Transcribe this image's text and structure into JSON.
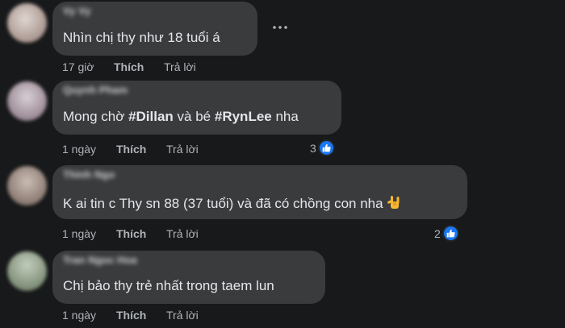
{
  "comments": [
    {
      "author": "Vy Vy",
      "text": "Nhìn chị thy như 18 tuổi á",
      "time": "17 giờ",
      "like_label": "Thích",
      "reply_label": "Trả lời",
      "avatar_color": "#c9bcb6"
    },
    {
      "author": "Quynh Pham",
      "text_parts": [
        "Mong chờ ",
        "#Dillan",
        " và bé ",
        "#RynLee",
        " nha"
      ],
      "time": "1 ngày",
      "like_label": "Thích",
      "reply_label": "Trả lời",
      "reaction_count": "3",
      "avatar_color": "#b3a4ad"
    },
    {
      "author": "Thinh Ngo",
      "text": "K ai tin c Thy sn 88 (37 tuổi) và đã có chồng con nha",
      "emoji": "love-you-gesture-emoji",
      "time": "1 ngày",
      "like_label": "Thích",
      "reply_label": "Trả lời",
      "reaction_count": "2",
      "avatar_color": "#9d8f88"
    },
    {
      "author": "Tran Ngoc Hoa",
      "text": "Chị bảo thy trẻ nhất trong taem lun",
      "time": "1 ngày",
      "like_label": "Thích",
      "reply_label": "Trả lời",
      "avatar_color": "#8f9c8a"
    }
  ],
  "icons": {
    "more": "more-options-icon",
    "like_badge": "thumbs-up-icon"
  },
  "colors": {
    "background": "#18191a",
    "bubble": "#3a3b3c",
    "like_blue": "#1877f2"
  }
}
